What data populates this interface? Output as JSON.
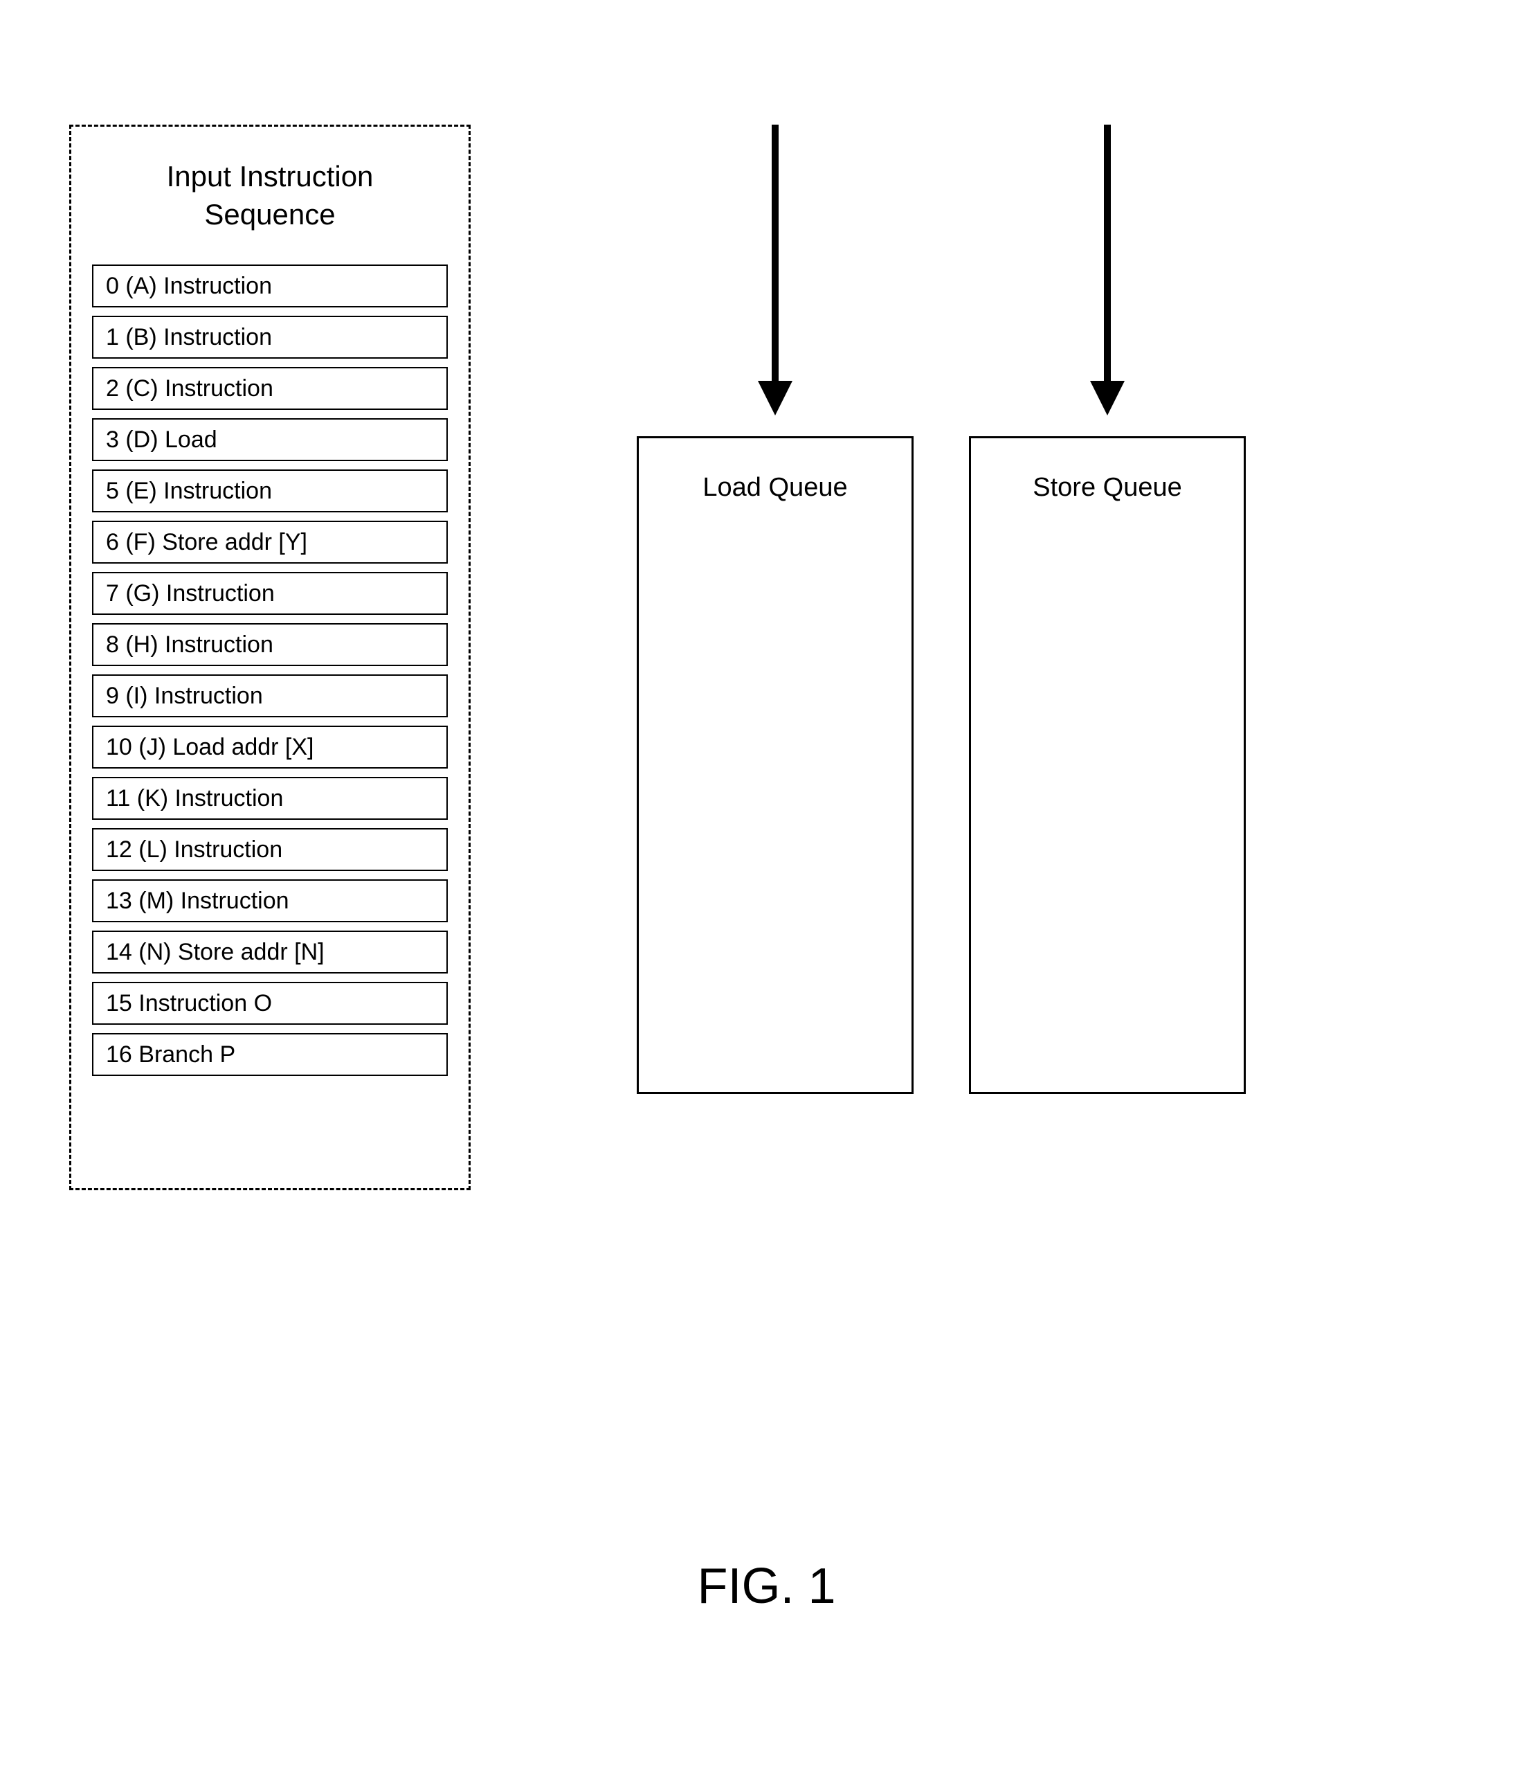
{
  "sequence": {
    "title_line1": "Input Instruction",
    "title_line2": "Sequence",
    "items": [
      "0  (A) Instruction",
      "1  (B) Instruction",
      "2  (C) Instruction",
      "3  (D) Load",
      "5  (E) Instruction",
      "6  (F) Store addr [Y]",
      "7  (G) Instruction",
      "8  (H) Instruction",
      "9  (I) Instruction",
      "10  (J) Load addr [X]",
      "11  (K) Instruction",
      "12  (L) Instruction",
      "13  (M) Instruction",
      "14  (N) Store addr [N]",
      "15  Instruction O",
      "16  Branch P"
    ]
  },
  "load_queue_label": "Load Queue",
  "store_queue_label": "Store Queue",
  "figure_label": "FIG. 1"
}
